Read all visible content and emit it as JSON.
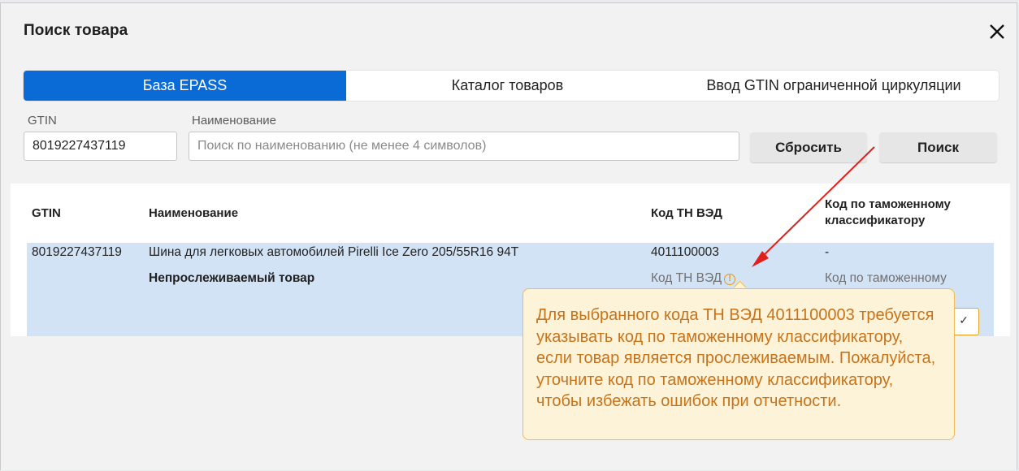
{
  "dialog": {
    "title": "Поиск товара",
    "close_icon": "close-icon"
  },
  "tabs": [
    {
      "label": "База EPASS",
      "active": true
    },
    {
      "label": "Каталог товаров",
      "active": false
    },
    {
      "label": "Ввод GTIN ограниченной циркуляции",
      "active": false
    }
  ],
  "search": {
    "gtin_label": "GTIN",
    "gtin_value": "8019227437119",
    "name_label": "Наименование",
    "name_placeholder": "Поиск по наименованию (не менее 4 символов)",
    "reset_label": "Сбросить",
    "search_label": "Поиск"
  },
  "table": {
    "headers": {
      "gtin": "GTIN",
      "name": "Наименование",
      "tn_ved": "Код ТН ВЭД",
      "customs_line1": "Код по таможенному",
      "customs_line2": "классификатору"
    },
    "row": {
      "gtin": "8019227437119",
      "name": "Шина для легковых автомобилей Pirelli Ice Zero 205/55R16 94T",
      "tn_ved": "4011100003",
      "customs_code": "-",
      "tracking_status": "Непрослеживаемый товар",
      "tn_ved_field_label": "Код ТН ВЭД",
      "customs_field_label": "Код по таможенному"
    }
  },
  "tooltip": {
    "text": "Для выбранного кода ТН ВЭД 4011100003 требуется указывать код по таможенному классификатору, если товар является прослеживаемым. Пожалуйста, уточните код по таможенному классификатору, чтобы избежать ошибок при отчетности."
  },
  "colors": {
    "accent": "#0a6ad6",
    "row_highlight": "#d3e3f6",
    "warning_text": "#c7731a",
    "warning_bg": "#fdf3d9",
    "annotation_arrow": "#e0201b"
  }
}
